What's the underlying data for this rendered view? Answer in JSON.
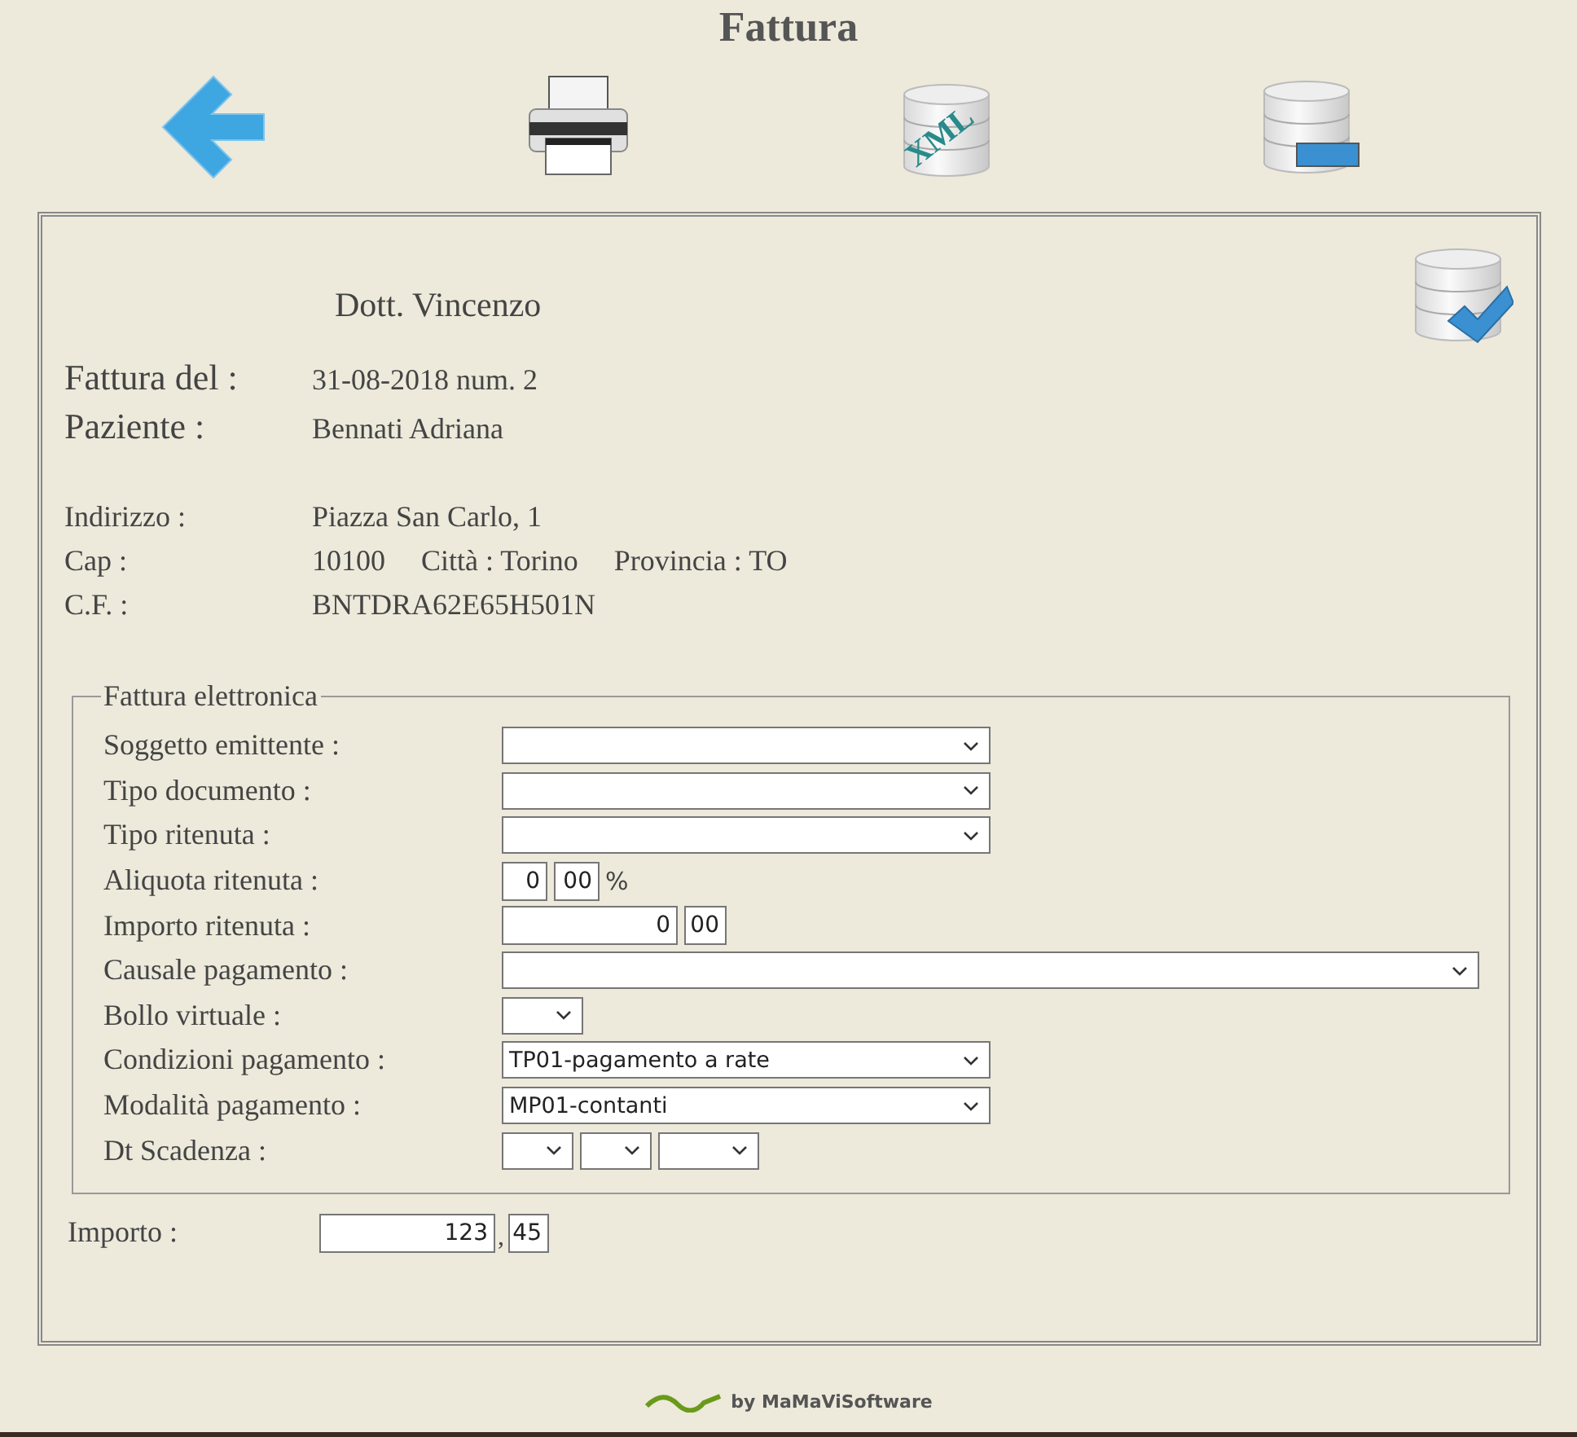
{
  "title": "Fattura",
  "toolbar": [
    {
      "kind": "back"
    },
    {
      "kind": "print"
    },
    {
      "kind": "xml",
      "label": "XML"
    },
    {
      "kind": "export"
    }
  ],
  "doctor": "Dott. Vincenzo",
  "header": [
    {
      "label": "Fattura del :",
      "value": "31-08-2018 num. 2"
    },
    {
      "label": "Paziente :",
      "value": "Bennati Adriana"
    }
  ],
  "address": {
    "indirizzo_label": "Indirizzo :",
    "indirizzo": "Piazza San Carlo, 1",
    "cap_label": "Cap :",
    "cap": "10100",
    "citta": "Città : Torino",
    "provincia": "Provincia : TO",
    "cf_label": "C.F. :",
    "cf": "BNTDRA62E65H501N"
  },
  "fieldset": {
    "legend": "Fattura elettronica",
    "rows": [
      {
        "label": "Soggetto emittente :",
        "kind": "select"
      },
      {
        "label": "Tipo documento :",
        "kind": "select"
      },
      {
        "label": "Tipo ritenuta :",
        "kind": "select"
      },
      {
        "label": "Aliquota ritenuta :",
        "kind": "percent",
        "int": "0",
        "frac": "00",
        "suffix": "%"
      },
      {
        "label": "Importo ritenuta :",
        "kind": "amount",
        "int": "0",
        "frac": "00"
      },
      {
        "label": "Causale pagamento :",
        "kind": "longselect"
      },
      {
        "label": "Bollo virtuale :",
        "kind": "shortselect"
      },
      {
        "label": "Condizioni pagamento :",
        "kind": "select",
        "value": "TP01-pagamento a rate"
      },
      {
        "label": "Modalità pagamento :",
        "kind": "select",
        "value": "MP01-contanti"
      },
      {
        "label": "Dt Scadenza :",
        "kind": "date"
      }
    ]
  },
  "importo": {
    "label": "Importo :",
    "int": "123",
    "sep": ",",
    "frac": "45"
  },
  "footer": "by MaMaViSoftware"
}
